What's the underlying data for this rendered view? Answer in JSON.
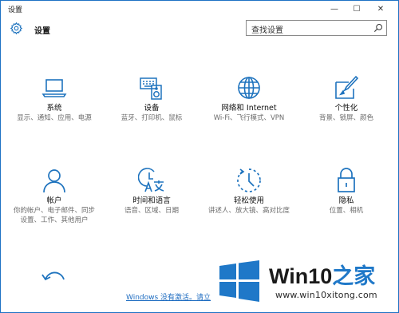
{
  "window": {
    "title": "设置",
    "minimize_glyph": "—",
    "maximize_glyph": "☐",
    "close_glyph": "✕"
  },
  "header": {
    "label": "设置",
    "search_placeholder": "查找设置"
  },
  "tiles": [
    {
      "name": "系统",
      "desc": "显示、通知、应用、电源",
      "icon": "laptop-icon"
    },
    {
      "name": "设备",
      "desc": "蓝牙、打印机、鼠标",
      "icon": "keyboard-speaker-icon"
    },
    {
      "name": "网络和 Internet",
      "desc": "Wi-Fi、飞行模式、VPN",
      "icon": "globe-icon"
    },
    {
      "name": "个性化",
      "desc": "背景、锁屏、颜色",
      "icon": "paint-brush-icon"
    },
    {
      "name": "帐户",
      "desc": "你的帐户、电子邮件、同步设置、工作、其他用户",
      "icon": "person-icon"
    },
    {
      "name": "时间和语言",
      "desc": "语音、区域、日期",
      "icon": "time-language-icon"
    },
    {
      "name": "轻松使用",
      "desc": "讲述人、放大镜、高对比度",
      "icon": "ease-of-access-icon"
    },
    {
      "name": "隐私",
      "desc": "位置、相机",
      "icon": "lock-icon"
    }
  ],
  "activation_link": "Windows 没有激活。请立",
  "watermark": {
    "brand_latin": "Win10",
    "brand_zh": "之家",
    "url": "www.win10xitong.com"
  },
  "colors": {
    "accent": "#1e73be",
    "logo_blue": "#1f78c8"
  }
}
